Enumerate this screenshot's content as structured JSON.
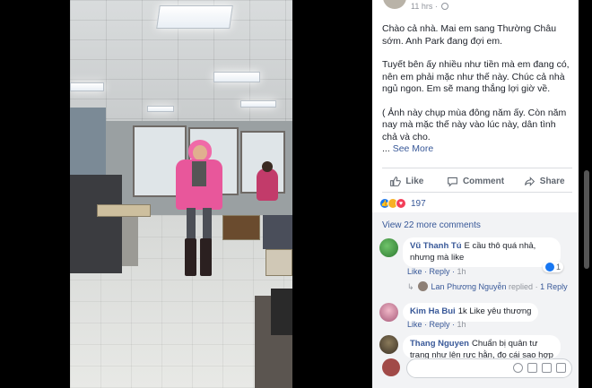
{
  "post": {
    "time": "11 hrs",
    "paragraphs": [
      "Chào cả nhà. Mai em sang Thường Châu sớm. Anh Park đang đợi em.",
      "Tuyết bên ấy nhiều như tiền mà em đang có, nên em phải mặc như thế này. Chúc cả nhà ngủ ngon. Em sẽ mang thắng lợi giờ về.",
      "( Ảnh này chụp mùa đông năm ấy. Còn năm nay mà mặc thế này vào lúc này, dân tình chả và cho."
    ],
    "ellipsis": "...",
    "see_more": "See More"
  },
  "actions": {
    "like": "Like",
    "comment": "Comment",
    "share": "Share"
  },
  "reactions": {
    "count": "197"
  },
  "comments": {
    "view_more": "View 22 more comments",
    "items": [
      {
        "name": "Vũ Thanh Tú",
        "text": "E cầu thô quá nhả, nhưng mà like",
        "like": "Like",
        "reply": "Reply",
        "time": "1h",
        "likes": "1"
      },
      {
        "name": "Kim Ha Bui",
        "text": "1k Like yêu thương",
        "like": "Like",
        "reply": "Reply",
        "time": "1h"
      },
      {
        "name": "Thang Nguyen",
        "text": "Chuẩn bị quân tư trang như lên rực hằn, đọ cái sao hợp tra bili",
        "like": "",
        "reply": "",
        "time": ""
      }
    ],
    "reply_preview": {
      "name": "Lan Phương Nguyễn",
      "action": "replied",
      "sep": "·",
      "count": "1 Reply"
    }
  },
  "colors": {
    "link": "#385898",
    "text": "#1d2129",
    "meta": "#90949c",
    "like_blue": "#1877f2",
    "love_red": "#f33e58",
    "haha_yellow": "#f7b125"
  }
}
